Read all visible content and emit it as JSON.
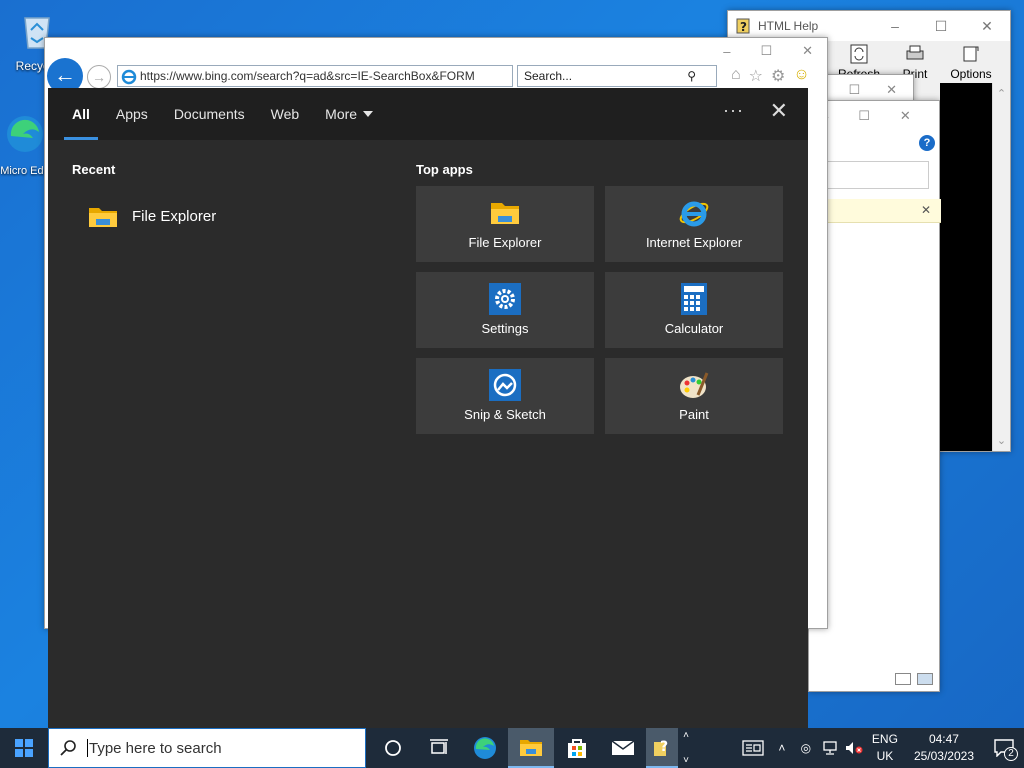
{
  "desktop": {
    "icons": [
      {
        "label": "Recycle"
      },
      {
        "label": "Micro Edg"
      }
    ]
  },
  "help_window": {
    "title": "HTML Help",
    "toolbar": [
      "Refresh",
      "Print",
      "Options"
    ]
  },
  "ie_window": {
    "address": "https://www.bing.com/search?q=ad&src=IE-SearchBox&FORM",
    "address_domain": "bing.com",
    "search_placeholder": "Search..."
  },
  "flyout": {
    "tabs": [
      "All",
      "Apps",
      "Documents",
      "Web",
      "More"
    ],
    "active_tab": "All",
    "recent_title": "Recent",
    "recent_items": [
      "File Explorer"
    ],
    "top_apps_title": "Top apps",
    "top_apps": [
      "File Explorer",
      "Internet Explorer",
      "Settings",
      "Calculator",
      "Snip & Sketch",
      "Paint"
    ]
  },
  "taskbar": {
    "search_placeholder": "Type here to search",
    "lang_top": "ENG",
    "lang_bottom": "UK",
    "time": "04:47",
    "date": "25/03/2023",
    "notification_count": "2"
  },
  "colors": {
    "accent": "#3a90e0",
    "flyout_bg": "#2b2b2b",
    "tile_bg": "#3c3c3c",
    "taskbar_bg": "#1e2b3a"
  }
}
